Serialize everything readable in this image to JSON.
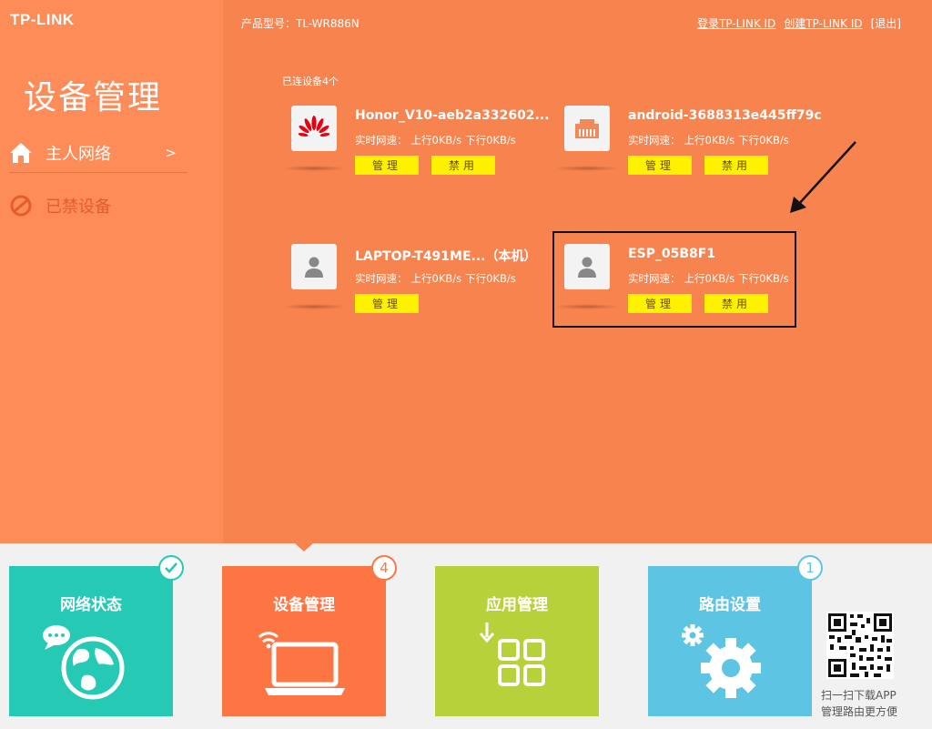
{
  "brand": {
    "logo": "TP-LINK"
  },
  "sidebar": {
    "title": "设备管理",
    "items": [
      {
        "label": "主人网络",
        "arrow": ">",
        "icon": "home-icon"
      },
      {
        "label": "已禁设备",
        "icon": "blocked-icon"
      }
    ]
  },
  "topbar": {
    "model": "产品型号：TL-WR886N",
    "login": "登录TP-LINK ID",
    "create": "创建TP-LINK ID",
    "logout": "[退出]"
  },
  "devices_section": {
    "count_label": "已连设备4个",
    "devices": [
      {
        "name": "Honor_V10-aeb2a332602...",
        "speed_label": "实时网速：",
        "up": "上行0KB/s",
        "down": "下行0KB/s",
        "manage": "管理",
        "block": "禁用",
        "icon": "huawei-logo-icon"
      },
      {
        "name": "android-3688313e445ff79c",
        "speed_label": "实时网速：",
        "up": "上行0KB/s",
        "down": "下行0KB/s",
        "manage": "管理",
        "block": "禁用",
        "icon": "ethernet-icon"
      },
      {
        "name": "LAPTOP-T491ME...（本机）",
        "speed_label": "实时网速：",
        "up": "上行0KB/s",
        "down": "下行0KB/s",
        "manage": "管理",
        "icon": "person-icon"
      },
      {
        "name": "ESP_05B8F1",
        "speed_label": "实时网速：",
        "up": "上行0KB/s",
        "down": "下行0KB/s",
        "manage": "管理",
        "block": "禁用",
        "icon": "person-icon"
      }
    ]
  },
  "tiles": [
    {
      "label": "网络状态",
      "badge": "",
      "color": "#26c9b4",
      "icon": "globe-icon",
      "badge_icon": "check-icon"
    },
    {
      "label": "设备管理",
      "badge": "4",
      "color": "#fd7543",
      "icon": "laptop-wifi-icon"
    },
    {
      "label": "应用管理",
      "badge": "",
      "color": "#b7d13b",
      "icon": "apps-grid-icon"
    },
    {
      "label": "路由设置",
      "badge": "1",
      "color": "#5ec4e4",
      "icon": "gear-icon"
    }
  ],
  "app_promo": {
    "line1": "扫一扫下载APP",
    "line2": "管理路由更方便"
  },
  "colors": {
    "sidebar": "#fd8c58",
    "main": "#f7834f",
    "button": "#fff100"
  }
}
